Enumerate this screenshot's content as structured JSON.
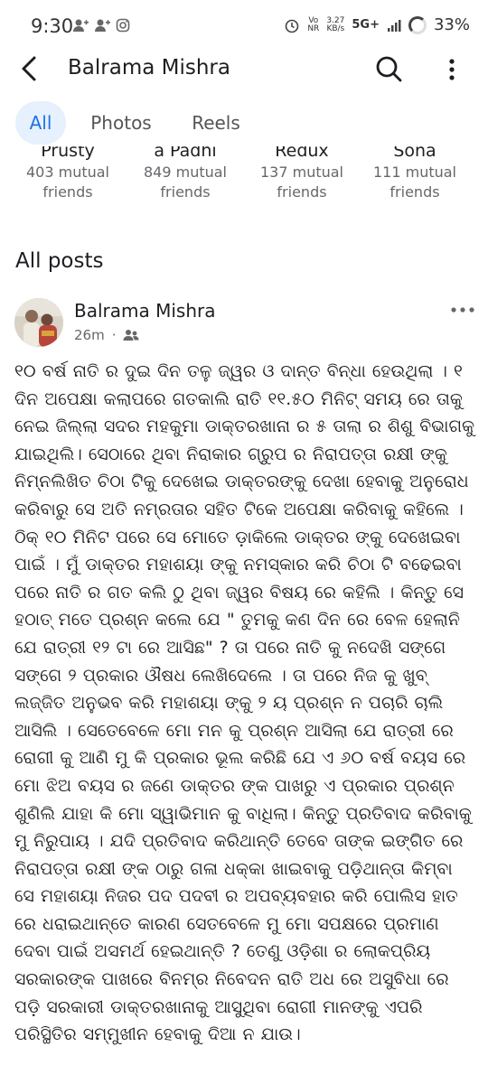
{
  "status_bar": {
    "time": "9:30",
    "network_top": "Vo",
    "network_bottom": "NR",
    "speed_top": "3.27",
    "speed_bottom": "KB/s",
    "signal": "5G+",
    "battery": "33%"
  },
  "header": {
    "title": "Balrama Mishra"
  },
  "tabs": [
    {
      "label": "All"
    },
    {
      "label": "Photos"
    },
    {
      "label": "Reels"
    }
  ],
  "friends": [
    {
      "name": "Prusty",
      "mutual_line1": "403 mutual",
      "mutual_line2": "friends"
    },
    {
      "name": "a Padhi",
      "mutual_line1": "849 mutual",
      "mutual_line2": "friends"
    },
    {
      "name": "Redux",
      "mutual_line1": "137 mutual",
      "mutual_line2": "friends"
    },
    {
      "name": "Sona",
      "mutual_line1": "111 mutual",
      "mutual_line2": "friends"
    }
  ],
  "section": {
    "title": "All posts"
  },
  "post": {
    "author": "Balrama Mishra",
    "time": "26m",
    "audience_icon": "friends-icon",
    "body": "୧୦ ବର୍ଷ ନାତି ର ଦୁଇ ଦିନ ତଳୁ ଜ୍ୱର ଓ ଦାନ୍ତ ବିନ୍ଧା ହେଉଥିଲା । ୧ ଦିନ ଅପେକ୍ଷା କଲାପରେ ଗତକାଲି ରାତି ୧୧.୫୦ ମିନିଟ୍ ସମୟ ରେ ତାକୁ ନେଇ ଜିଲ୍ଲା ସଦର ମହକୁମା ଡାକ୍ତରଖାନା ର ୫ ତାଲା ର ଶିଶୁ ବିଭାଗକୁ ଯାଇଥିଲି। ସେଠାରେ ଥିବା ନିରାକାର ଗ୍ରୁପ ର ନିରାପତ୍ତା ରକ୍ଷୀ ଙ୍କୁ ନିମ୍ନଲିଖିତ ଚିଠା ଟିକୁ ଦେଖେଇ ଡାକ୍ତରଙ୍କୁ ଦେଖା ହେବାକୁ ଅନୁରୋଧ କରିବାରୁ ସେ ଅତି ନମ୍ରତାର ସହିତ ଟିକେ ଅପେକ୍ଷା କରିବାକୁ କହିଲେ । ଠିକ୍ ୧୦ ମିନିଟ ପରେ ସେ ମୋତେ ଡ଼ାକିଲେ ଡାକ୍ତର ଙ୍କୁ ଦେଖେଇବା ପାଇଁ । ମୁଁ ଡାକ୍ତର ମହାଶୟା ଙ୍କୁ ନମସ୍କାର କରି  ଚିଠା ଟି ବଢେଇବା ପରେ ନାତି ର ଗତ କଲି ଠୁ ଥିବା ଜ୍ୱର ବିଷୟ ରେ କହିଲି । କିନ୍ତୁ ସେ ହଠାତ୍ ମତେ ପ୍ରଶ୍ନ କଲେ ଯେ \" ତୁମକୁ କଣ ଦିନ ରେ ବେଳ ହେଲାନି ଯେ ରାତ୍ରୀ ୧୨ ଟା ରେ ଆସିଛ\" ? ତା ପରେ ନାତି କୁ ନଦେଖି ସଙ୍ଗେ ସଙ୍ଗେ ୨ ପ୍ରକାର ଔଷଧ ଲେଖିଦେଲେ । ତା ପରେ ନିଜ କୁ ଖୁବ୍ ଲଜ୍ଜିତ ଅନୁଭବ କରି ମହାଶୟା ଙ୍କୁ ୨ ୟ ପ୍ରଶ୍ନ ନ ପଚାରି ଚାଲି ଆସିଲି । ସେତେବେଳେ ମୋ ମନ କୁ ପ୍ରଶ୍ନ ଆସିଲା ଯେ ରାତ୍ରୀ ରେ ରୋଗୀ କୁ ଆଣି ମୁ କି ପ୍ରକାର ଭୂଲ କରିଛି ଯେ ଏ ୬୦ ବର୍ଷ ବୟସ ରେ ମୋ ଝିଅ ବୟସ ର ଜଣେ ଡାକ୍ତର ଙ୍କ ପାଖରୁ ଏ ପ୍ରକାର ପ୍ରଶ୍ନ ଶୁଣିଲି ଯାହା କି ମୋ ସ୍ୱାଭିମାନ କୁ ବାଧିଲା। କିନ୍ତୁ ପ୍ରତିବାଦ କରିବାକୁ ମୁ ନିରୁପାୟ । ଯଦି ପ୍ରତିବାଦ କରିଥାନ୍ତି ତେବେ ତାଙ୍କ ଇଙ୍ଗିତ ରେ ନିରାପତ୍ତା ରକ୍ଷୀ ଙ୍କ ଠାରୁ ଗଳା ଧକ୍କା ଖାଇବାକୁ ପଡ଼ିଥାନ୍ତା କିମ୍ବା ସେ ମହାଶୟା ନିଜର ପଦ ପଦବୀ ର ଅପବ୍ୟବହାର କରି ପୋଲିସ ହାତ ରେ ଧରାଇଥାନ୍ତେ କାରଣ ସେତବେଳେ ମୁ ମୋ ସପକ୍ଷରେ ପ୍ରମାଣ ଦେବା ପାଇଁ ଅସମର୍ଥ ହେଇଥାନ୍ତି ? ତେଣୁ ଓଡ଼ିଶା ର ଲୋକପ୍ରିୟ ସରକାରଙ୍କ ପାଖରେ ବିନମ୍ର ନିବେଦନ ରାତି ଅଧ ରେ ଅସୁବିଧା ରେ ପଡ଼ି ସରକାରୀ ଡାକ୍ତରଖାନାକୁ ଆସୁଥିବା ରୋଗୀ ମାନଙ୍କୁ ଏପରି ପରିସ୍ଥିତିର ସମ୍ମୁଖୀନ ହେବାକୁ ଦିଆ ନ ଯାଉ।"
  },
  "colors": {
    "accent": "#1b74e4",
    "tab_active_bg": "#e7f0fd",
    "secondary_text": "#65676b",
    "primary_text": "#1c1e21"
  }
}
